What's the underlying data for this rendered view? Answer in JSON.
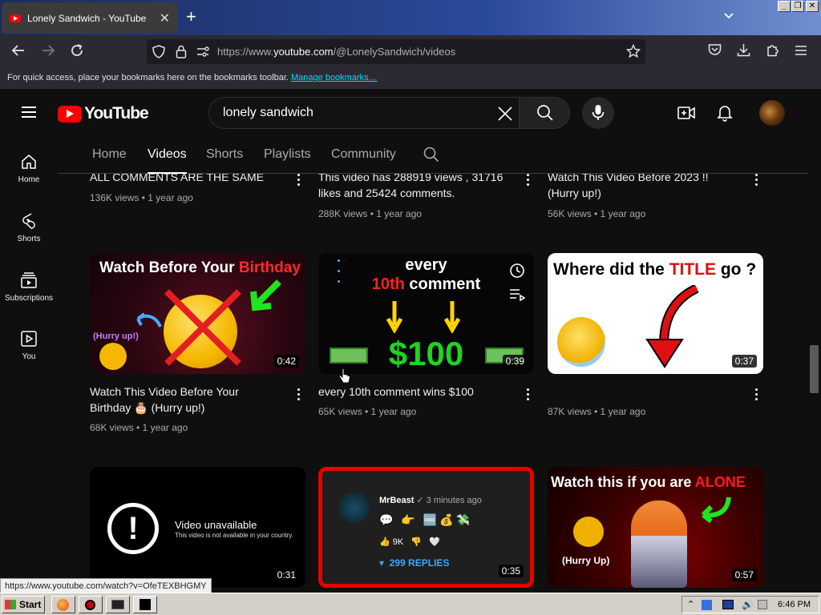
{
  "browser": {
    "tab_title": "Lonely Sandwich - YouTube",
    "url_prefix": "https://www.",
    "url_domain": "youtube.com",
    "url_path": "/@LonelySandwich/videos",
    "bookmarks_message": "For quick access, place your bookmarks here on the bookmarks toolbar.",
    "bookmarks_link": "Manage bookmarks…",
    "status_url": "https://www.youtube.com/watch?v=OfeTEXBHGMY"
  },
  "youtube": {
    "logo_text": "YouTube",
    "search_value": "lonely sandwich"
  },
  "sidebar": {
    "items": [
      {
        "label": "Home"
      },
      {
        "label": "Shorts"
      },
      {
        "label": "Subscriptions"
      },
      {
        "label": "You"
      }
    ]
  },
  "channel_tabs": [
    "Home",
    "Videos",
    "Shorts",
    "Playlists",
    "Community"
  ],
  "videos_row1": [
    {
      "title_line1": "ALL COMMENTS ARE THE SAME",
      "title_line2": "",
      "meta": "136K views • 1 year ago"
    },
    {
      "title_line1": "This video has 288919 views , 31716",
      "title_line2": "likes and 25424 comments.",
      "meta": "288K views • 1 year ago"
    },
    {
      "title_line1": "Watch This Video Before 2023 !!",
      "title_line2": "(Hurry up!)",
      "meta": "56K views • 1 year ago"
    }
  ],
  "videos_row2": [
    {
      "thumb_text_a": "Watch Before Your ",
      "thumb_text_b": "Birthday",
      "thumb_small": "(Hurry up!)",
      "duration": "0:42",
      "title_line1": "Watch This Video Before Your",
      "title_line2": "Birthday 🎂 (Hurry up!)",
      "meta": "68K views • 1 year ago"
    },
    {
      "thumb_text_a": "every",
      "thumb_text_b": "10th",
      "thumb_text_c": " comment",
      "thumb_money": "$100",
      "duration": "0:39",
      "title_line1": "every 10th comment wins $100",
      "meta": "65K views • 1 year ago"
    },
    {
      "thumb_text_a": "Where did the ",
      "thumb_text_b": "TITLE",
      "thumb_text_c": " go ?",
      "duration": "0:37",
      "title_line1": "",
      "meta": "87K views • 1 year ago"
    }
  ],
  "videos_row3": [
    {
      "unavail_title": "Video unavailable",
      "unavail_sub": "This video is not available in your country.",
      "duration": "0:31"
    },
    {
      "comment_author": "MrBeast",
      "comment_time": "3 minutes ago",
      "likes": "9K",
      "replies": "299 REPLIES",
      "duration": "0:35"
    },
    {
      "thumb_text_a": "Watch this if you are ",
      "thumb_text_b": "ALONE",
      "thumb_small": "(Hurry Up)",
      "duration": "0:57"
    }
  ],
  "taskbar": {
    "start_label": "Start",
    "clock": "6:46 PM"
  }
}
